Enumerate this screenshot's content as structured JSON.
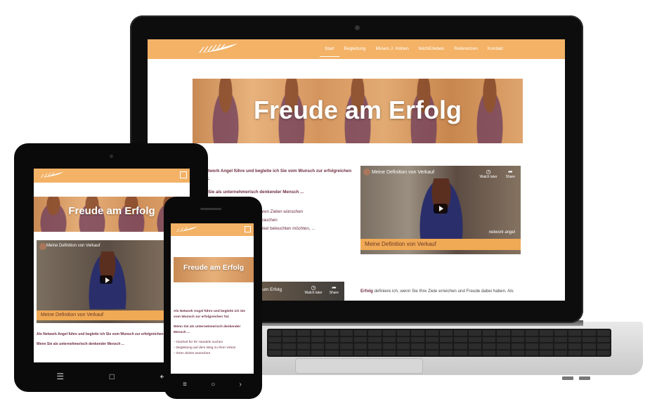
{
  "brand_color": "#f3b266",
  "laptop": {
    "nav": [
      "Start",
      "Begleitung",
      "Miriam J. Hohen",
      "fetchErleben",
      "Referenzen",
      "Kontakt"
    ],
    "hero_title": "Freude am Erfolg",
    "intro_line": "Network Angel führe und begleite ich Sie vom Wunsch zur erfolgreichen",
    "intro_line2": "Tat.",
    "question": "Sie als unternehmerisch denkender Mensch ...",
    "bullets": [
      "er Vision – Ihren Zielen wünschen",
      "rtnerschaft brauchen",
      "eren Blickwinkel beleuchten möchten, ..."
    ],
    "video_title": "Meine Definition von Verkauf",
    "video_band": "Meine Definition von Verkauf",
    "video_brand": "network angel",
    "watch_later": "Watch later",
    "share": "Share",
    "video2_title": "zum Erfolg",
    "bottom_bold": "Erfolg",
    "bottom_text": " definiere ich, wenn Sie Ihre Ziele erreichen und Freude dabei haben. Als"
  },
  "tablet": {
    "hero_title": "Freude am Erfolg",
    "video_title": "Meine Definition von Verkauf",
    "video_band": "Meine Definition von Verkauf",
    "text1": "Als Network Angel führe und begleite ich Sie vom Wunsch zur erfolgreichen Tat.",
    "text2": "Wenn Sie als unternehmerisch denkender Mensch ..."
  },
  "phone": {
    "hero_title": "Freude am Erfolg",
    "text1": "Als Network Angel führe und begleite ich Sie vom Wunsch zur erfolgreichen Tat.",
    "text2": "Wenn Sie als unternehmerisch denkender Mensch ...",
    "bullet1": "– Klarheit für Ihr Handeln suchen",
    "bullet2": "– Begleitung auf dem Weg zu Ihrer Vision",
    "bullet3": "– Ihren Zielen wünschen"
  }
}
